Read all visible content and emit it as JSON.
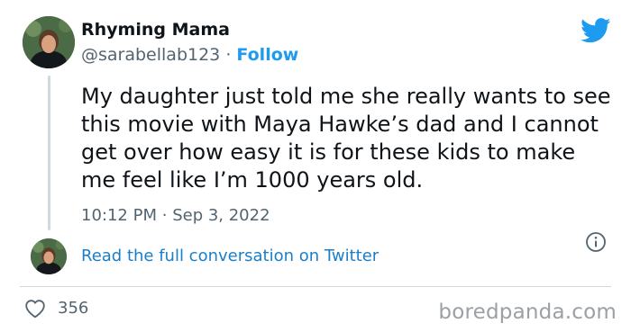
{
  "author": {
    "name": "Rhyming Mama",
    "handle": "@sarabellab123",
    "separator": "·",
    "follow_label": "Follow"
  },
  "tweet": {
    "text": "My daughter just told me she really wants to see this movie with Maya Hawke’s dad and I cannot get over how easy it is for these kids to make me feel like I’m 1000 years old.",
    "time": "10:12 PM",
    "date": "Sep 3, 2022",
    "time_separator": "·"
  },
  "read_more": {
    "label": "Read the full conversation on Twitter"
  },
  "engagement": {
    "likes": "356"
  },
  "watermark": "boredpanda.com",
  "icons": {
    "brand": "twitter-bird-icon",
    "info": "info-icon",
    "like": "heart-icon"
  },
  "colors": {
    "twitter_blue": "#1d9bf0",
    "link_blue": "#1a7fc9",
    "text": "#0f1419",
    "muted": "#536471"
  }
}
